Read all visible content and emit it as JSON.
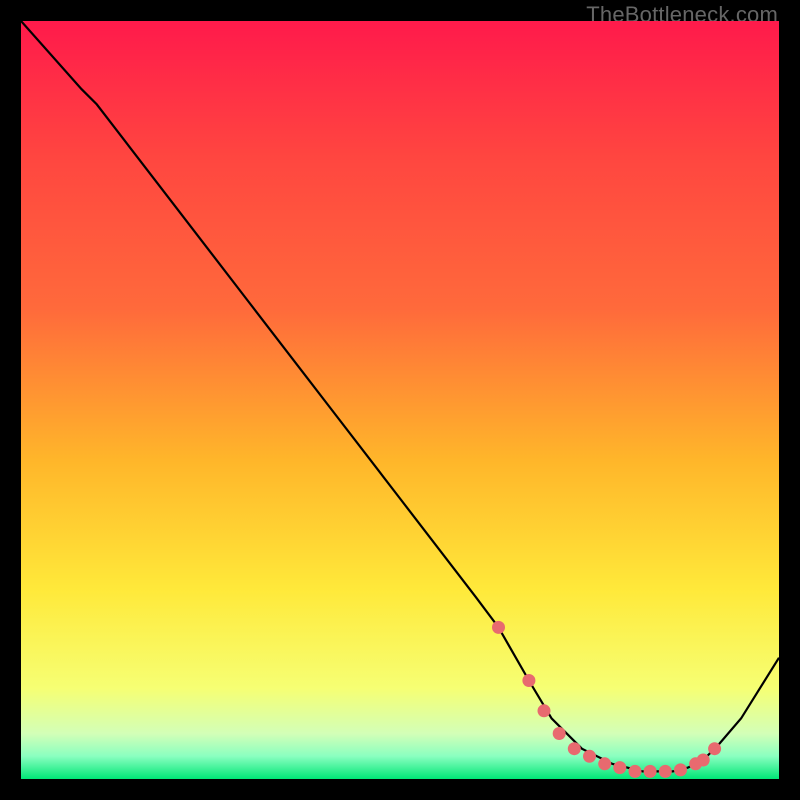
{
  "watermark": "TheBottleneck.com",
  "colors": {
    "bg": "#000000",
    "grad_top": "#ff1a4b",
    "grad_upper": "#ff6a3b",
    "grad_mid1": "#ffb62a",
    "grad_mid2": "#ffe93a",
    "grad_low1": "#f6ff73",
    "grad_low2": "#d3ffb7",
    "grad_bottom": "#00e676",
    "curve": "#000000",
    "dots": "#e86a6f"
  },
  "chart_data": {
    "type": "line",
    "title": "",
    "xlabel": "",
    "ylabel": "",
    "xlim": [
      0,
      100
    ],
    "ylim": [
      0,
      100
    ],
    "series": [
      {
        "name": "bottleneck-curve",
        "x": [
          0,
          8,
          10,
          20,
          30,
          40,
          50,
          60,
          63,
          67,
          70,
          74,
          78,
          82,
          86,
          88,
          90,
          92,
          95,
          100
        ],
        "y": [
          100,
          91,
          89,
          76,
          63,
          50,
          37,
          24,
          20,
          13,
          8,
          4,
          2,
          1,
          1,
          1.5,
          2.5,
          4.5,
          8,
          16
        ]
      }
    ],
    "markers": {
      "name": "highlight-dots",
      "x": [
        63,
        67,
        69,
        71,
        73,
        75,
        77,
        79,
        81,
        83,
        85,
        87,
        89,
        90,
        91.5
      ],
      "y": [
        20,
        13,
        9,
        6,
        4,
        3,
        2,
        1.5,
        1,
        1,
        1,
        1.2,
        2,
        2.5,
        4
      ]
    }
  }
}
